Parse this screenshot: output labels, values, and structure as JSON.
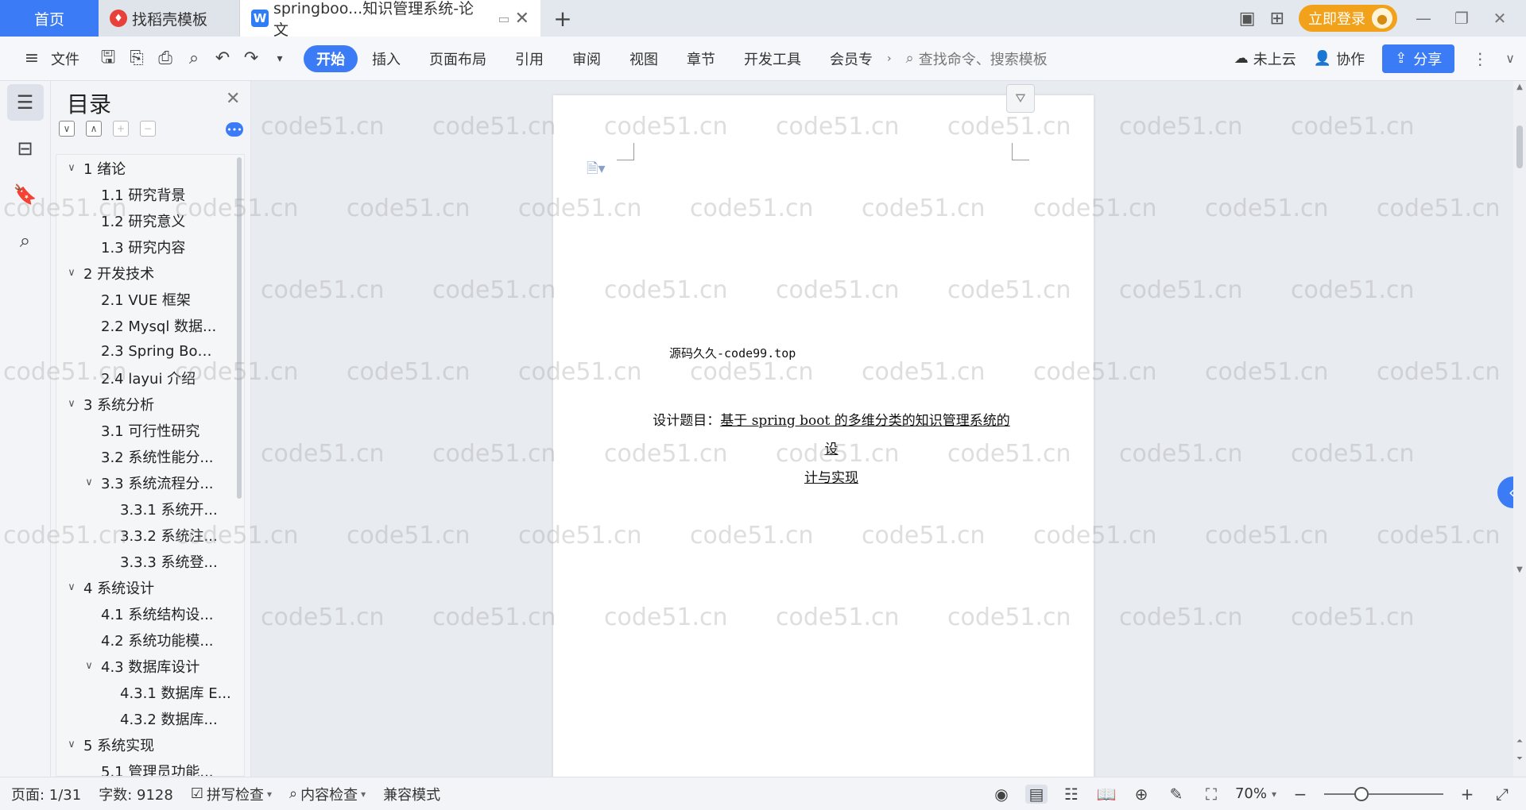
{
  "tabs": {
    "home": "首页",
    "daoke": "找稻壳模板",
    "doc": "springboo...知识管理系统-论文",
    "new_tab": "+"
  },
  "account": {
    "login_label": "立即登录"
  },
  "toolbar": {
    "file_label": "文件",
    "menus": [
      "开始",
      "插入",
      "页面布局",
      "引用",
      "审阅",
      "视图",
      "章节",
      "开发工具",
      "会员专"
    ],
    "search_placeholder": "查找命令、搜索模板",
    "cloud_label": "未上云",
    "collab_label": "协作",
    "share_label": "分享"
  },
  "toc": {
    "title": "目录",
    "items": [
      {
        "level": "l1",
        "chev": "∨",
        "label": "1  绪论"
      },
      {
        "level": "l2",
        "chev": "",
        "label": "1.1  研究背景"
      },
      {
        "level": "l2",
        "chev": "",
        "label": "1.2  研究意义"
      },
      {
        "level": "l2",
        "chev": "",
        "label": "1.3  研究内容"
      },
      {
        "level": "l1",
        "chev": "∨",
        "label": "2  开发技术"
      },
      {
        "level": "l2",
        "chev": "",
        "label": "2.1 VUE 框架"
      },
      {
        "level": "l2",
        "chev": "",
        "label": "2.2 Mysql 数据..."
      },
      {
        "level": "l2",
        "chev": "",
        "label": "2.3 Spring Boot ..."
      },
      {
        "level": "l2",
        "chev": "",
        "label": "2.4 layui 介绍"
      },
      {
        "level": "l1",
        "chev": "∨",
        "label": "3  系统分析"
      },
      {
        "level": "l2",
        "chev": "",
        "label": "3.1 可行性研究"
      },
      {
        "level": "l2",
        "chev": "",
        "label": "3.2 系统性能分..."
      },
      {
        "level": "l2c",
        "chev": "∨",
        "label": "3.3  系统流程分..."
      },
      {
        "level": "l3",
        "chev": "",
        "label": "3.3.1  系统开..."
      },
      {
        "level": "l3",
        "chev": "",
        "label": "3.3.2  系统注..."
      },
      {
        "level": "l3",
        "chev": "",
        "label": "3.3.3  系统登..."
      },
      {
        "level": "l1",
        "chev": "∨",
        "label": "4  系统设计"
      },
      {
        "level": "l2",
        "chev": "",
        "label": "4.1  系统结构设..."
      },
      {
        "level": "l2",
        "chev": "",
        "label": "4.2 系统功能模..."
      },
      {
        "level": "l2c",
        "chev": "∨",
        "label": "4.3 数据库设计"
      },
      {
        "level": "l3",
        "chev": "",
        "label": "4.3.1 数据库 E..."
      },
      {
        "level": "l3",
        "chev": "",
        "label": "4.3.2  数据库..."
      },
      {
        "level": "l1",
        "chev": "∨",
        "label": "5  系统实现"
      },
      {
        "level": "l2",
        "chev": "",
        "label": "5.1  管理员功能..."
      }
    ]
  },
  "document": {
    "source_line": "源码久久-code99.top",
    "title_prefix": "设计题目：",
    "title_line1": "基于 spring boot 的多维分类的知识管理系统的设",
    "title_line2": "计与实现"
  },
  "watermark": "code51.cn",
  "status": {
    "page": "页面: 1/31",
    "words": "字数: 9128",
    "spellcheck": "拼写检查",
    "content_check": "内容检查",
    "compat_mode": "兼容模式",
    "zoom": "70%"
  },
  "colors": {
    "accent": "#3c7bf6",
    "login": "#f2a21a"
  }
}
